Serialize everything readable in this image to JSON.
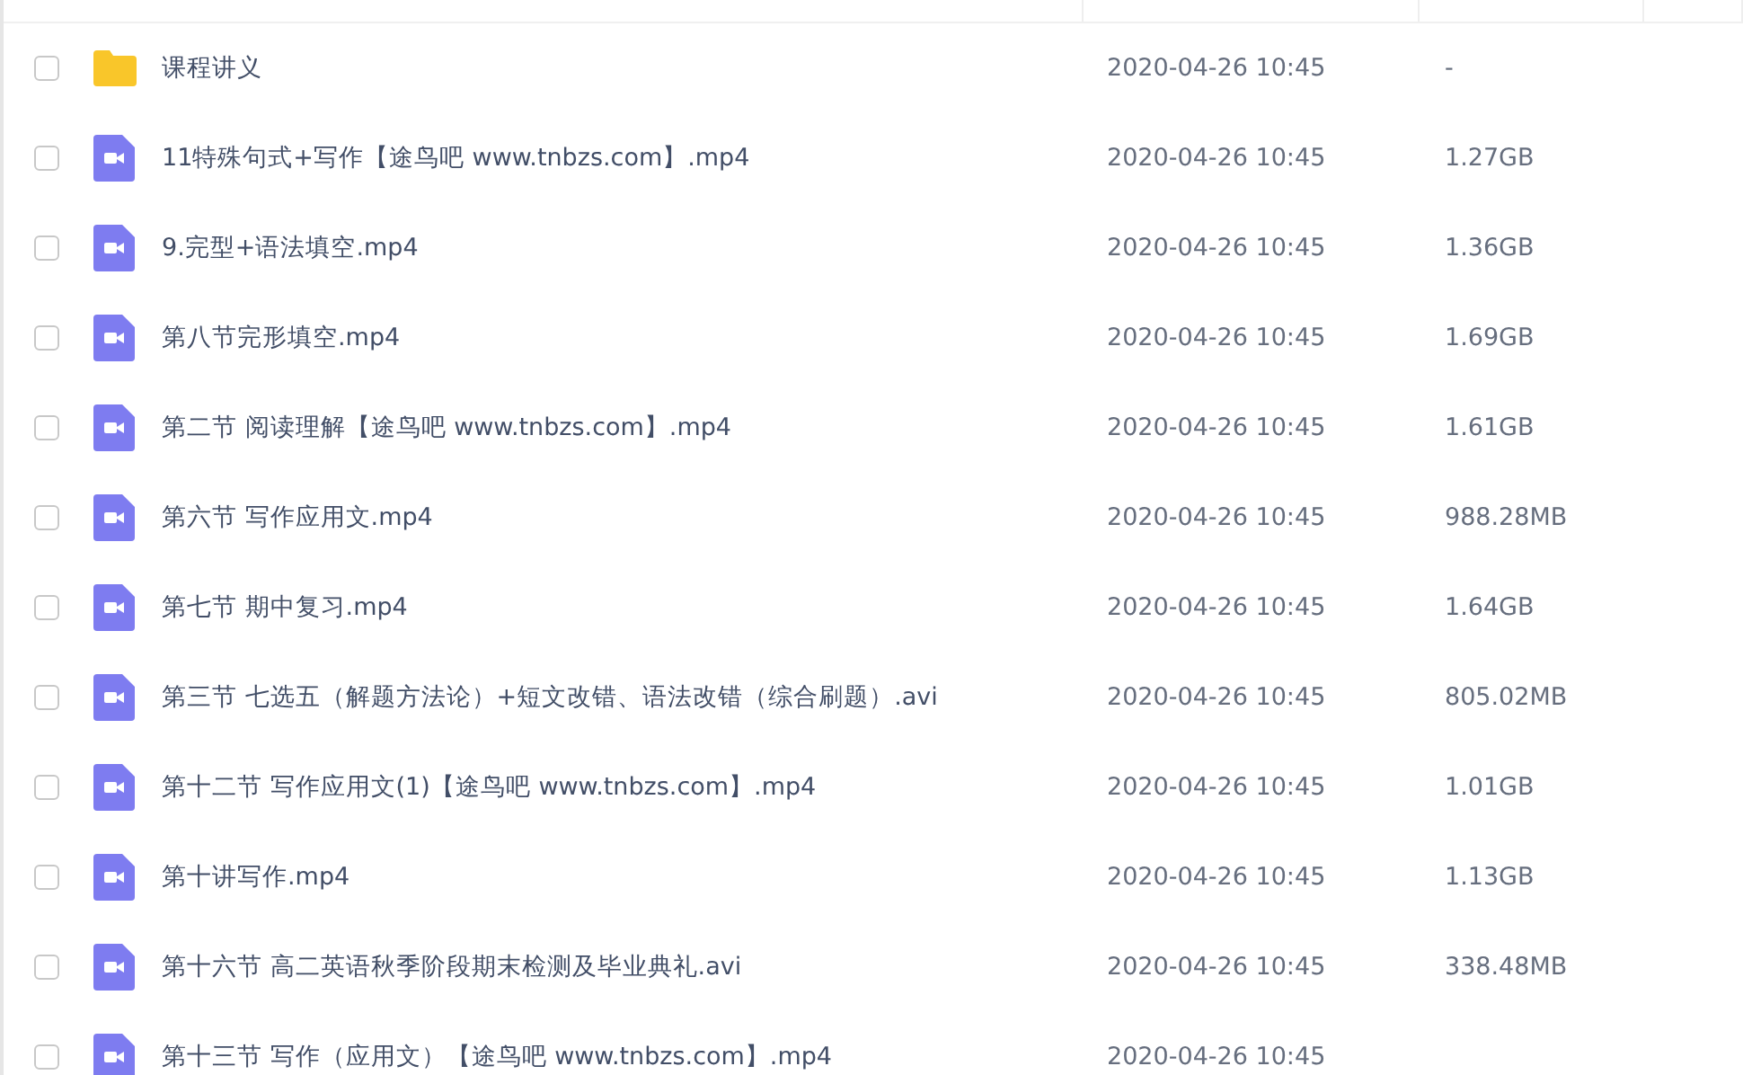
{
  "files": [
    {
      "kind": "folder",
      "name": "课程讲义",
      "modified": "2020-04-26 10:45",
      "size": "-",
      "checked": false
    },
    {
      "kind": "video",
      "name": "11特殊句式+写作【途鸟吧 www.tnbzs.com】.mp4",
      "modified": "2020-04-26 10:45",
      "size": "1.27GB",
      "checked": false
    },
    {
      "kind": "video",
      "name": "9.完型+语法填空.mp4",
      "modified": "2020-04-26 10:45",
      "size": "1.36GB",
      "checked": false
    },
    {
      "kind": "video",
      "name": "第八节完形填空.mp4",
      "modified": "2020-04-26 10:45",
      "size": "1.69GB",
      "checked": false
    },
    {
      "kind": "video",
      "name": "第二节 阅读理解【途鸟吧 www.tnbzs.com】.mp4",
      "modified": "2020-04-26 10:45",
      "size": "1.61GB",
      "checked": false
    },
    {
      "kind": "video",
      "name": "第六节 写作应用文.mp4",
      "modified": "2020-04-26 10:45",
      "size": "988.28MB",
      "checked": false
    },
    {
      "kind": "video",
      "name": "第七节 期中复习.mp4",
      "modified": "2020-04-26 10:45",
      "size": "1.64GB",
      "checked": false
    },
    {
      "kind": "video",
      "name": "第三节 七选五（解题方法论）+短文改错、语法改错（综合刷题）.avi",
      "modified": "2020-04-26 10:45",
      "size": "805.02MB",
      "checked": false
    },
    {
      "kind": "video",
      "name": "第十二节 写作应用文(1)【途鸟吧 www.tnbzs.com】.mp4",
      "modified": "2020-04-26 10:45",
      "size": "1.01GB",
      "checked": false
    },
    {
      "kind": "video",
      "name": "第十讲写作.mp4",
      "modified": "2020-04-26 10:45",
      "size": "1.13GB",
      "checked": false
    },
    {
      "kind": "video",
      "name": "第十六节 高二英语秋季阶段期末检测及毕业典礼.avi",
      "modified": "2020-04-26 10:45",
      "size": "338.48MB",
      "checked": false
    },
    {
      "kind": "video",
      "name": "第十三节 写作（应用文）【途鸟吧 www.tnbzs.com】.mp4",
      "modified": "2020-04-26 10:45",
      "checked": false
    }
  ]
}
